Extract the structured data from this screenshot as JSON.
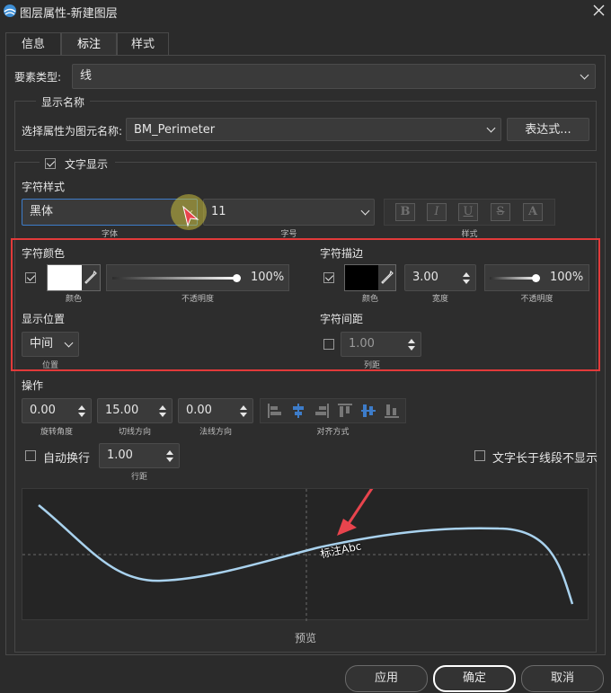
{
  "window": {
    "title": "图层属性-新建图层"
  },
  "tabs": [
    {
      "label": "信息"
    },
    {
      "label": "标注"
    },
    {
      "label": "样式"
    }
  ],
  "element_type": {
    "label": "要素类型:",
    "value": "线"
  },
  "display_name": {
    "group_title": "显示名称",
    "field_label": "选择属性为图元名称:",
    "value": "BM_Perimeter",
    "expr_button": "表达式..."
  },
  "text_display": {
    "checkbox_label": "文字显示",
    "checked": true
  },
  "char_style": {
    "title": "字符样式",
    "font": "黑体",
    "font_caption": "字体",
    "size": "11",
    "size_caption": "字号",
    "style_caption": "样式",
    "style_buttons": [
      "B",
      "I",
      "U",
      "S",
      "A"
    ]
  },
  "char_color": {
    "title": "字符颜色",
    "checked": true,
    "color": "#ffffff",
    "color_caption": "颜色",
    "opacity": "100%",
    "opacity_caption": "不透明度",
    "opacity_fraction": 1.0
  },
  "char_stroke": {
    "title": "字符描边",
    "checked": true,
    "color": "#000000",
    "color_caption": "颜色",
    "width": "3.00",
    "width_caption": "宽度",
    "opacity": "100%",
    "opacity_caption": "不透明度",
    "opacity_fraction": 1.0
  },
  "display_position": {
    "title": "显示位置",
    "value": "中间",
    "caption": "位置"
  },
  "char_spacing": {
    "title": "字符间距",
    "checked": false,
    "value": "1.00",
    "caption": "列距"
  },
  "operations": {
    "title": "操作",
    "rotation": "0.00",
    "rotation_caption": "旋转角度",
    "tangent": "15.00",
    "tangent_caption": "切线方向",
    "normal": "0.00",
    "normal_caption": "法线方向",
    "align_caption": "对齐方式"
  },
  "auto_wrap": {
    "label": "自动换行",
    "checked": false,
    "line_spacing": "1.00",
    "line_spacing_caption": "行距"
  },
  "hide_long_text": {
    "label": "文字长于线段不显示",
    "checked": false
  },
  "preview": {
    "label_text": "标注Abc",
    "caption": "预览"
  },
  "buttons": {
    "apply": "应用",
    "ok": "确定",
    "cancel": "取消"
  },
  "colors": {
    "highlight_border": "#e23a3a",
    "arrow": "#e8444d",
    "curve": "#a9d2ee",
    "focus": "#3d7cc9"
  }
}
